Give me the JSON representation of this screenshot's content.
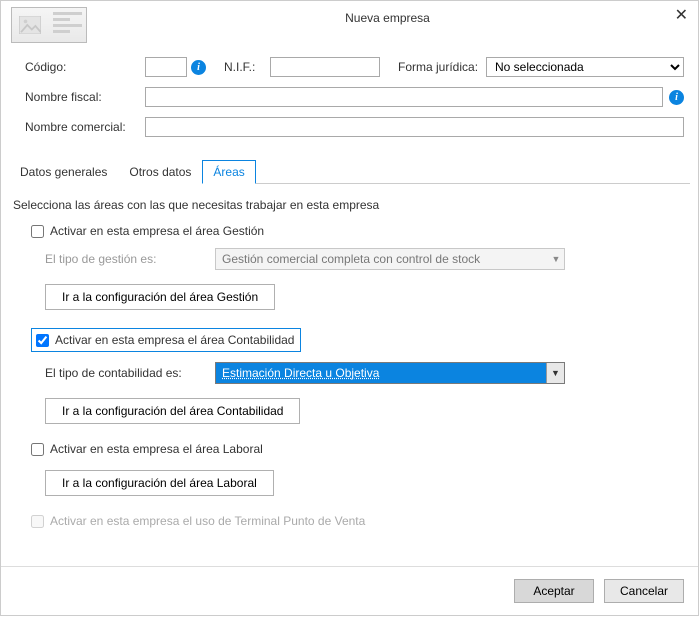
{
  "dialog": {
    "title": "Nueva empresa"
  },
  "fields": {
    "codigo_label": "Código:",
    "codigo_value": "",
    "nif_label": "N.I.F.:",
    "nif_value": "",
    "forma_label": "Forma jurídica:",
    "forma_selected": "No seleccionada",
    "nombre_fiscal_label": "Nombre fiscal:",
    "nombre_fiscal_value": "",
    "nombre_comercial_label": "Nombre comercial:",
    "nombre_comercial_value": ""
  },
  "tabs": {
    "generales": "Datos generales",
    "otros": "Otros datos",
    "areas": "Áreas"
  },
  "areas": {
    "intro": "Selecciona las áreas con las que necesitas trabajar en esta empresa",
    "gestion": {
      "checkbox_label": "Activar en esta empresa el área Gestión",
      "checked": false,
      "tipo_label": "El tipo de gestión es:",
      "tipo_value": "Gestión comercial completa con control de stock",
      "config_btn": "Ir a la configuración del área Gestión"
    },
    "contabilidad": {
      "checkbox_label": "Activar en esta empresa el área Contabilidad",
      "checked": true,
      "tipo_label": "El tipo de contabilidad es:",
      "tipo_value": "Estimación Directa u Objetiva",
      "config_btn": "Ir a la configuración del área Contabilidad"
    },
    "laboral": {
      "checkbox_label": "Activar en esta empresa el área Laboral",
      "checked": false,
      "config_btn": "Ir a la configuración del área Laboral"
    },
    "tpv": {
      "checkbox_label": "Activar en esta empresa el uso de Terminal Punto de Venta",
      "checked": false
    }
  },
  "footer": {
    "accept": "Aceptar",
    "cancel": "Cancelar"
  }
}
